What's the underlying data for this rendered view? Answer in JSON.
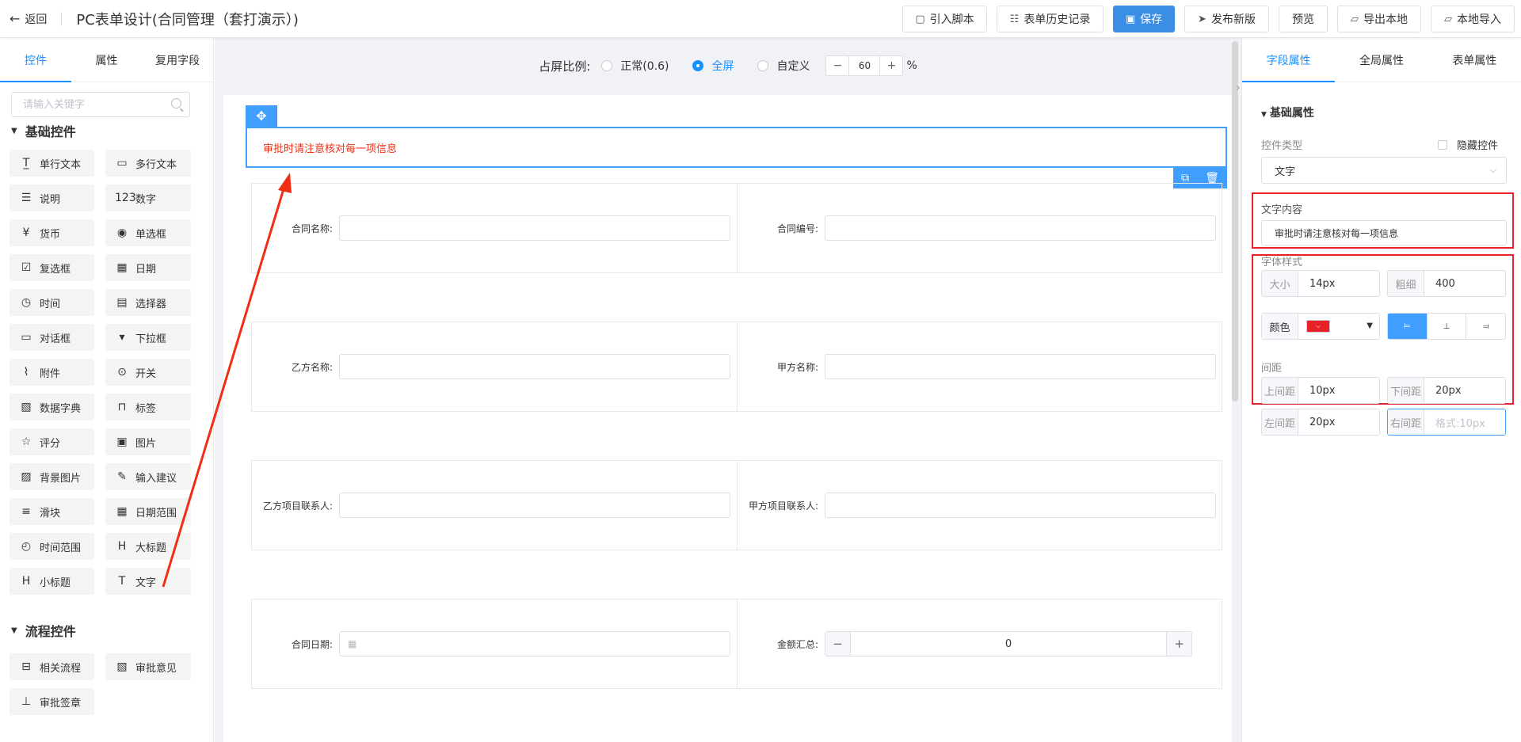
{
  "header": {
    "back_label": "返回",
    "title": "PC表单设计(合同管理（套打演示）)",
    "buttons": {
      "import_script": "引入脚本",
      "history": "表单历史记录",
      "save": "保存",
      "publish": "发布新版",
      "preview": "预览",
      "export_local": "导出本地",
      "import_local": "本地导入"
    }
  },
  "left_panel": {
    "tabs": [
      "控件",
      "属性",
      "复用字段"
    ],
    "search_placeholder": "请输入关键字",
    "basic_title": "基础控件",
    "basic_items": [
      {
        "icon": "T̲",
        "label": "单行文本"
      },
      {
        "icon": "▭",
        "label": "多行文本"
      },
      {
        "icon": "☰",
        "label": "说明"
      },
      {
        "icon": "123",
        "label": "数字"
      },
      {
        "icon": "¥",
        "label": "货币"
      },
      {
        "icon": "◉",
        "label": "单选框"
      },
      {
        "icon": "☑",
        "label": "复选框"
      },
      {
        "icon": "▦",
        "label": "日期"
      },
      {
        "icon": "◷",
        "label": "时间"
      },
      {
        "icon": "▤",
        "label": "选择器"
      },
      {
        "icon": "▭",
        "label": "对话框"
      },
      {
        "icon": "▾",
        "label": "下拉框"
      },
      {
        "icon": "⌇",
        "label": "附件"
      },
      {
        "icon": "⊙",
        "label": "开关"
      },
      {
        "icon": "▧",
        "label": "数据字典"
      },
      {
        "icon": "⊓",
        "label": "标签"
      },
      {
        "icon": "☆",
        "label": "评分"
      },
      {
        "icon": "▣",
        "label": "图片"
      },
      {
        "icon": "▨",
        "label": "背景图片"
      },
      {
        "icon": "✎",
        "label": "输入建议"
      },
      {
        "icon": "≡",
        "label": "滑块"
      },
      {
        "icon": "▦",
        "label": "日期范围"
      },
      {
        "icon": "◴",
        "label": "时间范围"
      },
      {
        "icon": "H",
        "label": "大标题"
      },
      {
        "icon": "H",
        "label": "小标题"
      },
      {
        "icon": "T",
        "label": "文字"
      }
    ],
    "flow_title": "流程控件",
    "flow_items": [
      {
        "icon": "⊟",
        "label": "相关流程"
      },
      {
        "icon": "▧",
        "label": "审批意见"
      },
      {
        "icon": "⊥",
        "label": "审批签章"
      }
    ]
  },
  "center": {
    "ratio_label": "占屏比例:",
    "ratio_options": [
      "正常(0.6)",
      "全屏",
      "自定义"
    ],
    "ratio_selected": "全屏",
    "ratio_value": "60",
    "ratio_unit": "%",
    "stepper_minus": "−",
    "stepper_plus": "+",
    "selected_text": "审批时请注意核对每一项信息",
    "rows": [
      [
        {
          "label": "合同名称:"
        },
        {
          "label": "合同编号:"
        }
      ],
      [
        {
          "label": "乙方名称:"
        },
        {
          "label": "甲方名称:"
        }
      ],
      [
        {
          "label": "乙方项目联系人:"
        },
        {
          "label": "甲方项目联系人:"
        }
      ],
      [
        {
          "label": "合同日期:"
        },
        {
          "label": "金额汇总:"
        }
      ]
    ],
    "amount_value": "0"
  },
  "right_panel": {
    "tabs": [
      "字段属性",
      "全局属性",
      "表单属性"
    ],
    "basic_title": "基础属性",
    "control_type_label": "控件类型",
    "hide_control_label": "隐藏控件",
    "control_type_value": "文字",
    "text_content_label": "文字内容",
    "text_content_value": "审批时请注意核对每一项信息",
    "font_style_label": "字体样式",
    "size_label": "大小",
    "size_value": "14px",
    "weight_label": "粗细",
    "weight_value": "400",
    "color_label": "颜色",
    "font_color": "#e6212a",
    "spacing_label": "间距",
    "top_label": "上间距",
    "top_value": "10px",
    "bottom_label": "下间距",
    "bottom_value": "20px",
    "left_label": "左间距",
    "left_value": "20px",
    "right_label": "右间距",
    "right_placeholder": "格式:10px"
  }
}
